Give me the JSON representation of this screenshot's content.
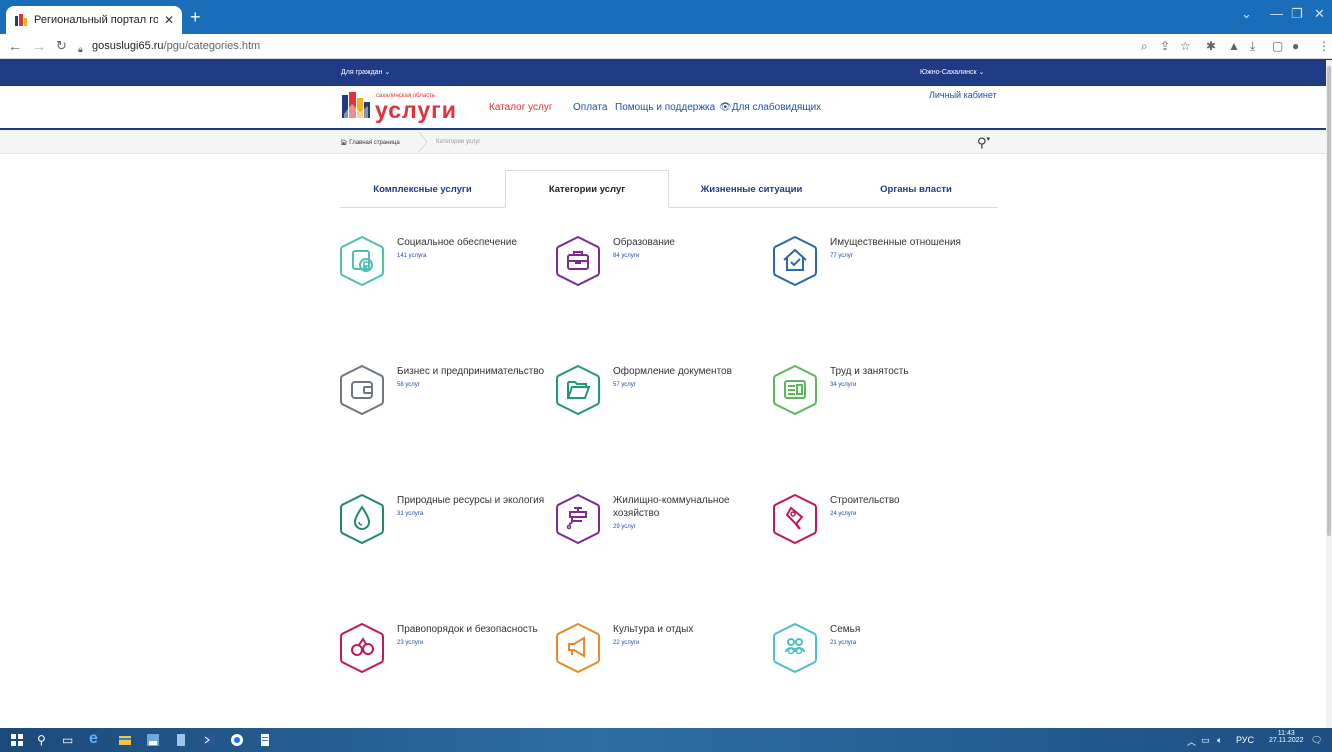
{
  "browser": {
    "tab_title": "Региональный портал государс",
    "url_host": "gosuslugi65.ru",
    "url_path": "/pgu/categories.htm"
  },
  "site": {
    "for_citizens": "Для граждан",
    "city": "Южно-Сахалинск",
    "logo_region": "сахалинская область",
    "logo_main": "услуги",
    "nav": [
      "Каталог услуг",
      "Оплата",
      "Помощь и поддержка",
      "Для слабовидящих"
    ],
    "cabinet": "Личный кабинет",
    "breadcrumb_home": "Главная страница",
    "breadcrumb_current": "Категории услуг",
    "brand_color": "#1f3b86",
    "accent_color": "#e0323a"
  },
  "tabs": [
    "Комплексные услуги",
    "Категории услуг",
    "Жизненные ситуации",
    "Органы власти"
  ],
  "categories": [
    {
      "name": "Социальное обеспечение",
      "count": "141 услуга",
      "color": "#4fc0b0",
      "icon": "wallet-ruble-icon"
    },
    {
      "name": "Образование",
      "count": "84 услуги",
      "color": "#7b2d8e",
      "icon": "briefcase-icon"
    },
    {
      "name": "Имущественные отношения",
      "count": "77 услуг",
      "color": "#2a6aa8",
      "icon": "house-check-icon"
    },
    {
      "name": "Бизнес и предпринимательство",
      "count": "58 услуг",
      "color": "#707780",
      "icon": "wallet-icon"
    },
    {
      "name": "Оформление документов",
      "count": "57 услуг",
      "color": "#1f9a72",
      "icon": "folder-icon"
    },
    {
      "name": "Труд и занятость",
      "count": "34 услуги",
      "color": "#5cb85c",
      "icon": "employment-card-icon"
    },
    {
      "name": "Природные ресурсы и экология",
      "count": "31 услуга",
      "color": "#1f8a64",
      "icon": "water-drop-icon"
    },
    {
      "name": "Жилищно-коммунальное хозяйство",
      "count": "29 услуг",
      "color": "#7b2d8e",
      "icon": "faucet-icon"
    },
    {
      "name": "Строительство",
      "count": "24 услуги",
      "color": "#c2185b",
      "icon": "trowel-icon"
    },
    {
      "name": "Правопорядок и безопасность",
      "count": "23 услуги",
      "color": "#c2185b",
      "icon": "handcuffs-icon"
    },
    {
      "name": "Культура и отдых",
      "count": "22 услуги",
      "color": "#e8892b",
      "icon": "megaphone-icon"
    },
    {
      "name": "Семья",
      "count": "21 услуга",
      "color": "#4fbfc4",
      "icon": "family-icon"
    }
  ],
  "tray": {
    "lang": "РУС",
    "time": "11:43",
    "date": "27.11.2022"
  }
}
